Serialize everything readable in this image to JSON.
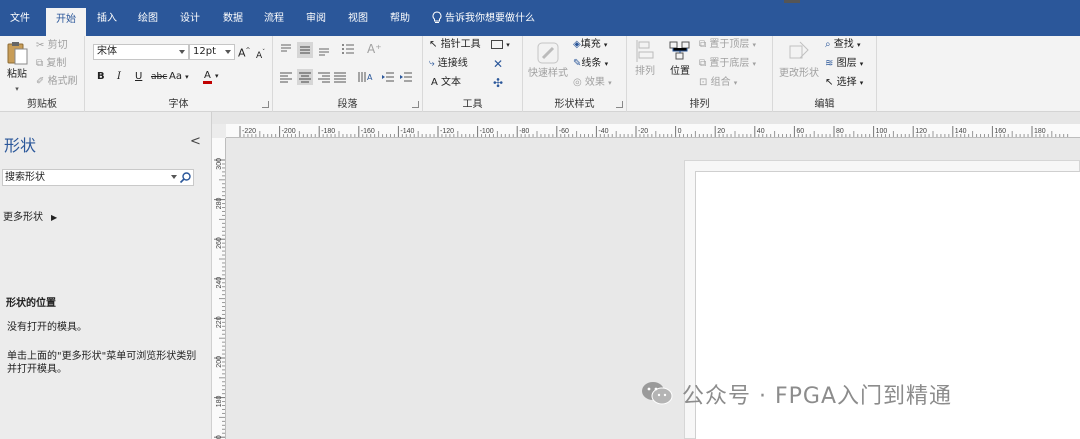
{
  "menu": {
    "tabs": [
      "文件",
      "开始",
      "插入",
      "绘图",
      "设计",
      "数据",
      "流程",
      "审阅",
      "视图",
      "帮助"
    ],
    "active": "开始",
    "tell_me": "告诉我你想要做什么"
  },
  "ribbon": {
    "clipboard": {
      "paste": "粘贴",
      "cut": "剪切",
      "copy": "复制",
      "format_painter": "格式刷",
      "label": "剪贴板"
    },
    "font": {
      "name": "宋体",
      "size": "12pt",
      "grow": "A",
      "shrink": "A",
      "bold": "B",
      "italic": "I",
      "underline": "U",
      "strike": "abc",
      "case": "Aa",
      "color": "A",
      "label": "字体"
    },
    "paragraph": {
      "label": "段落"
    },
    "tools": {
      "pointer": "指针工具",
      "connector": "连接线",
      "text": "文本",
      "label": "工具"
    },
    "shape_styles": {
      "quick_styles": "快速样式",
      "fill": "填充",
      "line": "线条",
      "effects": "效果",
      "label": "形状样式"
    },
    "arrange": {
      "align": "排列",
      "position": "位置",
      "bring_front": "置于顶层",
      "send_back": "置于底层",
      "group": "组合",
      "label": "排列"
    },
    "editing": {
      "change_shape": "更改形状",
      "find": "查找",
      "layers": "图层",
      "select": "选择",
      "label": "编辑"
    }
  },
  "pane": {
    "title": "形状",
    "collapse": "<",
    "search_placeholder": "搜索形状",
    "more_shapes": "更多形状",
    "location_heading": "形状的位置",
    "no_stencils": "没有打开的模具。",
    "hint": "单击上面的\"更多形状\"菜单可浏览形状类别并打开模具。"
  },
  "ruler": {
    "h_labels": [
      "-220",
      "-200",
      "-180",
      "-160",
      "-140",
      "-120",
      "-100",
      "-80",
      "-60",
      "-40",
      "-20",
      "0",
      "20",
      "40",
      "60",
      "80",
      "100",
      "120",
      "140",
      "160",
      "180"
    ],
    "v_labels": [
      "300",
      "280",
      "260",
      "240",
      "220",
      "200",
      "180",
      "160"
    ]
  },
  "watermark": "公众号 · FPGA入门到精通",
  "colors": {
    "accent": "#2b579a",
    "ribbon_bg": "#f3f3f3",
    "canvas_bg": "#e8e8e8"
  }
}
